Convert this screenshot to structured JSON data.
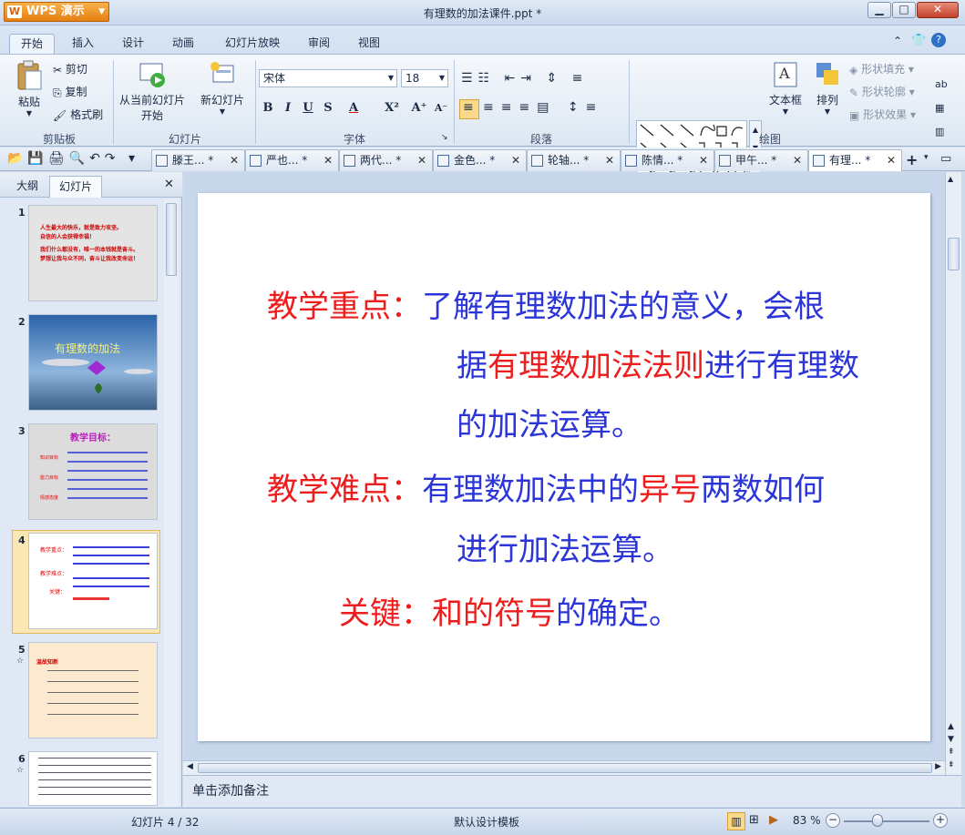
{
  "app": {
    "name": "WPS 演示",
    "window_title": "有理数的加法课件.ppt *"
  },
  "window_controls": {
    "minimize": "▁",
    "maximize": "□",
    "close": "✕"
  },
  "ribbon_tabs": [
    "开始",
    "插入",
    "设计",
    "动画",
    "幻灯片放映",
    "审阅",
    "视图"
  ],
  "ribbon": {
    "clipboard": {
      "paste": "粘贴",
      "cut": "剪切",
      "copy": "复制",
      "format_painter": "格式刷",
      "label": "剪贴板"
    },
    "slides": {
      "from_current_line1": "从当前幻灯片",
      "from_current_line2": "开始",
      "new_slide": "新幻灯片",
      "label": "幻灯片"
    },
    "font": {
      "name": "宋体",
      "size": "18",
      "label": "字体"
    },
    "paragraph": {
      "label": "段落"
    },
    "drawing": {
      "textbox": "文本框",
      "arrange": "排列",
      "shape_fill": "形状填充",
      "shape_outline": "形状轮廓",
      "shape_effects": "形状效果",
      "label": "绘图"
    }
  },
  "doc_tabs": [
    "滕王... *",
    "严也... *",
    "两代... *",
    "金色... *",
    "轮轴... *",
    "陈情... *",
    "甲午... *",
    "有理... *"
  ],
  "left_pane": {
    "tab_outline": "大纲",
    "tab_slides": "幻灯片",
    "close": "✕"
  },
  "thumbnails": [
    {
      "num": "1",
      "lines": [
        "人生最大的快乐，就是致力攻坚。",
        "自信的人会获得幸福！",
        "我们什么都没有，唯一的本钱就是奋斗。",
        "梦想让我与众不同，奋斗让我改变命运！"
      ]
    },
    {
      "num": "2",
      "title": "有理数的加法"
    },
    {
      "num": "3",
      "title": "教学目标：",
      "rows": [
        "知识目标",
        "能力目标",
        "情感态度"
      ]
    },
    {
      "num": "4",
      "rows": [
        "教学重点：",
        "教学难点：",
        "关键："
      ]
    },
    {
      "num": "5",
      "title": "温故知新"
    },
    {
      "num": "6"
    }
  ],
  "slide": {
    "key_points_label": "教学重点：",
    "key_points_1": "了解有理数加法的意义，会根",
    "key_points_2a": "据",
    "key_points_2b": "有理数加法法则",
    "key_points_2c": "进行有理数",
    "key_points_3": "的加法运算。",
    "difficulty_label": "教学难点：",
    "difficulty_1a": "有理数加法中的",
    "difficulty_1b": "异号",
    "difficulty_1c": "两数如何",
    "difficulty_2": "进行加法运算。",
    "key_label": "关键：",
    "key_a": "和的符号",
    "key_b": "的确定。"
  },
  "notes_placeholder": "单击添加备注",
  "status": {
    "slide_counter": "幻灯片 4 / 32",
    "template": "默认设计模板",
    "zoom": "83 %"
  },
  "colors": {
    "accent_red": "#ee1d1d",
    "accent_blue": "#2b35d8",
    "wps_orange": "#e57f12"
  }
}
